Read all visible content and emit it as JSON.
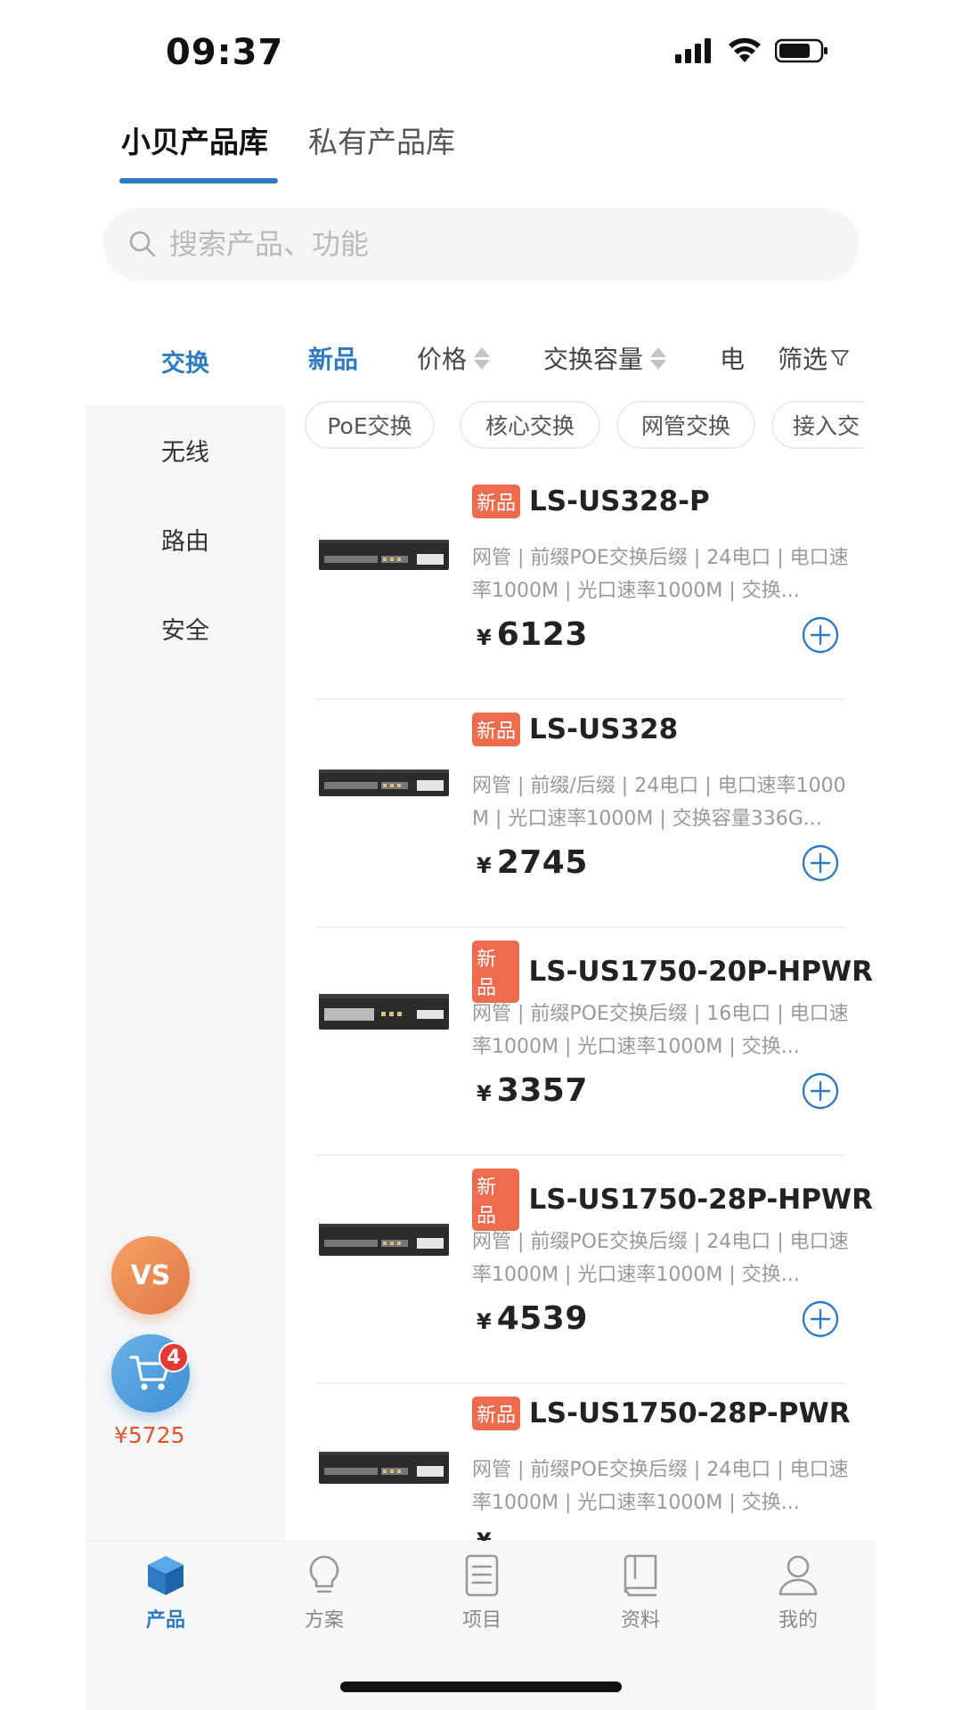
{
  "status_bar": {
    "time": "09:37"
  },
  "top_tabs": [
    {
      "label": "小贝产品库",
      "active": true
    },
    {
      "label": "私有产品库",
      "active": false
    }
  ],
  "search": {
    "placeholder": "搜索产品、功能"
  },
  "sidebar": {
    "items": [
      {
        "label": "交换",
        "active": true
      },
      {
        "label": "无线",
        "active": false
      },
      {
        "label": "路由",
        "active": false
      },
      {
        "label": "安全",
        "active": false
      }
    ]
  },
  "sort_bar": {
    "items": [
      {
        "label": "新品",
        "active": true
      },
      {
        "label": "价格",
        "active": false
      },
      {
        "label": "交换容量",
        "active": false
      },
      {
        "label": "电",
        "active": false
      }
    ],
    "filter_label": "筛选"
  },
  "chips": [
    "PoE交换",
    "核心交换",
    "网管交换",
    "接入交"
  ],
  "products": [
    {
      "badge": "新品",
      "name": "LS-US328-P",
      "desc": "网管 | 前缀POE交换后缀 | 24电口 | 电口速率1000M | 光口速率1000M | 交换...",
      "currency": "¥",
      "price": "6123"
    },
    {
      "badge": "新品",
      "name": "LS-US328",
      "desc": "网管 | 前缀/后缀 | 24电口 | 电口速率1000M | 光口速率1000M | 交换容量336G...",
      "currency": "¥",
      "price": "2745"
    },
    {
      "badge": "新品",
      "name": "LS-US1750-20P-HPWR",
      "desc": "网管 | 前缀POE交换后缀 | 16电口 | 电口速率1000M | 光口速率1000M | 交换...",
      "currency": "¥",
      "price": "3357"
    },
    {
      "badge": "新品",
      "name": "LS-US1750-28P-HPWR",
      "desc": "网管 | 前缀POE交换后缀 | 24电口 | 电口速率1000M | 光口速率1000M | 交换...",
      "currency": "¥",
      "price": "4539"
    },
    {
      "badge": "新品",
      "name": "LS-US1750-28P-PWR",
      "desc": "网管 | 前缀POE交换后缀 | 24电口 | 电口速率1000M | 光口速率1000M | 交换...",
      "currency": "¥",
      "price": ""
    }
  ],
  "floating": {
    "vs_label": "VS",
    "cart_count": "4",
    "cart_total": "¥5725"
  },
  "bottom_nav": [
    {
      "label": "产品",
      "icon": "cube-icon",
      "active": true
    },
    {
      "label": "方案",
      "icon": "lightbulb-icon",
      "active": false
    },
    {
      "label": "项目",
      "icon": "document-list-icon",
      "active": false
    },
    {
      "label": "资料",
      "icon": "book-icon",
      "active": false
    },
    {
      "label": "我的",
      "icon": "user-icon",
      "active": false
    }
  ],
  "colors": {
    "accent": "#2f7bc2",
    "badge": "#ee6b4e",
    "vs_orange": "#e27845",
    "cart_blue": "#3d8ed3",
    "cart_total": "#e0552c"
  }
}
